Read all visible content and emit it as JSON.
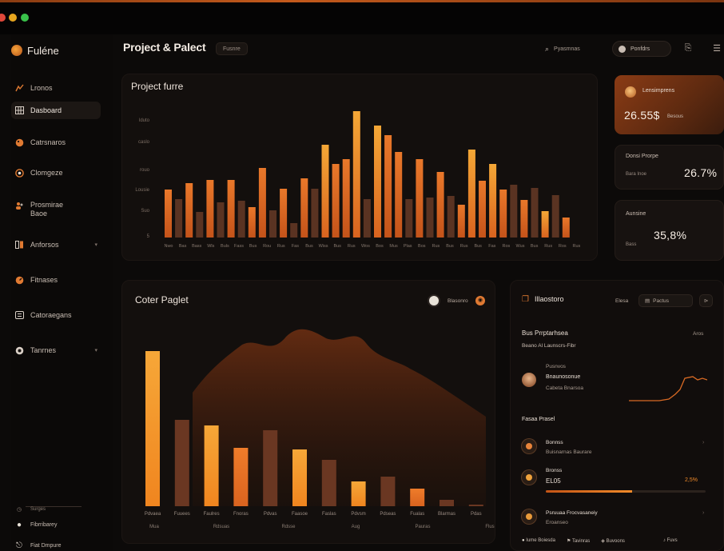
{
  "app": {
    "brand": "Fuléne"
  },
  "header": {
    "title": "Project & Palect",
    "chip": "Fusnre",
    "search_label": "Pyasmnas",
    "user_label": "Ponfdrs"
  },
  "sidebar": {
    "items": [
      {
        "label": "Lronos",
        "icon": "chart-icon"
      },
      {
        "label": "Dasboard",
        "icon": "grid-icon"
      },
      {
        "label": "Catrsnaros",
        "icon": "palette-icon"
      },
      {
        "label": "Clomgeze",
        "icon": "target-icon"
      },
      {
        "label": "Prosmirae Baoe",
        "icon": "people-icon"
      },
      {
        "label": "Anforsos",
        "icon": "columns-icon"
      },
      {
        "label": "Fitnases",
        "icon": "gauge-icon"
      },
      {
        "label": "Catoraegans",
        "icon": "list-icon"
      },
      {
        "label": "Tanrnes",
        "icon": "settings-icon"
      }
    ],
    "footer": [
      {
        "label": "Surges"
      },
      {
        "label": "Fibrribarey"
      },
      {
        "label": "Fiat Dmpure"
      }
    ]
  },
  "top_chart": {
    "title": "Project furre",
    "y_ticks": [
      "lduto",
      "caslo",
      "rouo",
      "Lousie",
      "Suo",
      "5"
    ],
    "x_ticks": [
      "Nwo",
      "Bas",
      "Bass",
      "Wls",
      "Buls",
      "Fass",
      "Bus",
      "Rou",
      "Rus",
      "Fas",
      "Bus",
      "Wiss",
      "Bus",
      "Rus",
      "Wos",
      "Bos",
      "Mus",
      "Plas",
      "Bos",
      "Rus",
      "Bus",
      "Rus",
      "Bus",
      "Fas",
      "Ros",
      "Wus",
      "Bus",
      "Rus",
      "Ros",
      "Rus"
    ],
    "colors": {
      "bright": "#f4a736",
      "mid": "#e9782a",
      "dark": "#5a3322"
    }
  },
  "stats": [
    {
      "label": "Lensimprens",
      "value": "26.55$",
      "sub": "Besous"
    },
    {
      "label": "Donsi Prorpe",
      "value": "26.7%",
      "sub": "Bara Inoe"
    },
    {
      "label": "Aunsine",
      "value": "35,8%",
      "sub": "Bass"
    }
  ],
  "bottom_chart": {
    "title": "Coter Paglet",
    "button": "Blasonro",
    "x_ticks": [
      "Pdvaea",
      "Fuuees",
      "Faulres",
      "Fnoras",
      "Pdvas",
      "Faasoe",
      "Faslas",
      "Pdvsm",
      "Pdseas",
      "Fualas",
      "Blarmas",
      "Pdas"
    ],
    "x_ticks2": [
      "Mua",
      "Rdsuas",
      "Rdsse",
      "Aug",
      "Pauras",
      "Flus"
    ]
  },
  "right_panel": {
    "title": "Illaostoro",
    "btn1": "Elesa",
    "btn2": "Pactus",
    "section1_title": "Bus Prrptarhsea",
    "section1_more": "Aros",
    "section1_sub": "Beano  Al  Launscrs-Fibr",
    "item1_small": "Pusnvos",
    "item1_title": "Bnaunosonue",
    "item1_sub": "Cabeta  Bnarsoa",
    "section2_title": "Fasaa Prasel",
    "list": [
      {
        "title": "Bonnss",
        "sub": "Buisnarnas  Baurare",
        "value": "",
        "progress": 0
      },
      {
        "title": "Bronss",
        "sub": "EL05",
        "value": "2,5%",
        "progress": 0.54
      },
      {
        "title": "Psruuaa Frocvasaneiy",
        "sub": "Eroanseo",
        "value": "",
        "progress": 0
      }
    ],
    "footer": [
      "Iume Boiesda",
      "Tavinras",
      "Buvoons",
      "Fuvs"
    ]
  }
}
